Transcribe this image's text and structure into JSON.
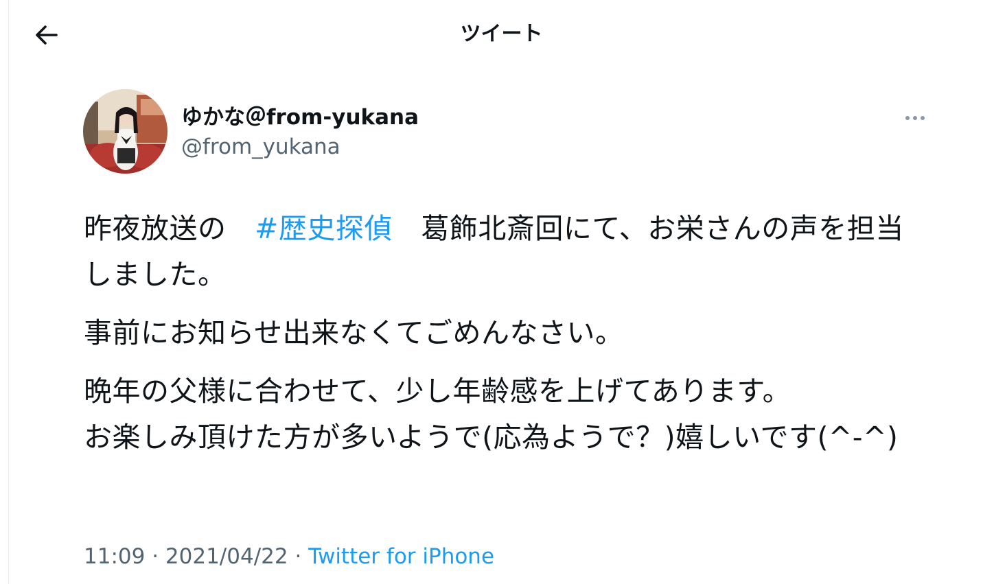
{
  "header": {
    "title": "ツイート",
    "back_icon": "arrow-left-icon"
  },
  "author": {
    "display_name": "ゆかな＠from-yukana",
    "handle": "@from_yukana",
    "avatar": "user-avatar-photo",
    "more_icon": "more-dots-icon"
  },
  "tweet": {
    "line1_pre": "昨夜放送の　",
    "hashtag": "#歴史探偵",
    "line1_post": "　葛飾北斎回にて、お栄さんの声を担当しました。",
    "para2": "事前にお知らせ出来なくてごめんなさい。",
    "para3_line1": "晩年の父様に合わせて、少し年齢感を上げてあります。",
    "para3_line2": "お楽しみ頂けた方が多いようで(応為ようで？)嬉しいです(^-^)"
  },
  "meta": {
    "time": "11:09",
    "separator": " · ",
    "date": "2021/04/22",
    "source": "Twitter for iPhone"
  },
  "colors": {
    "accent": "#1d9bf0",
    "text": "#0f1419",
    "secondary": "#536471",
    "border": "#e6ecf0"
  }
}
